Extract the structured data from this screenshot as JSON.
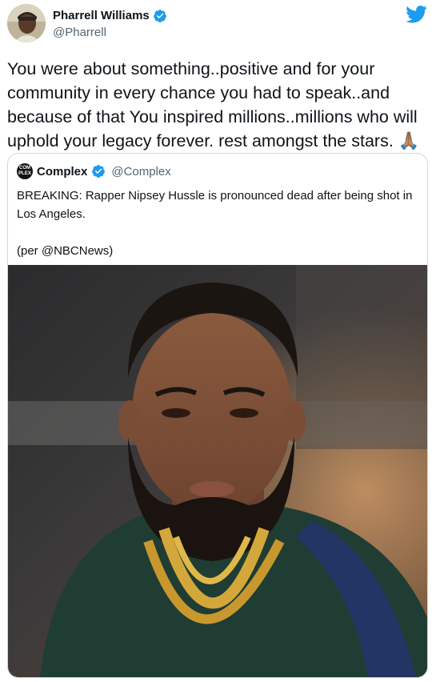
{
  "author": {
    "name": "Pharrell Williams",
    "handle": "@Pharrell",
    "verified": true,
    "avatar_icon": "profile-photo"
  },
  "brand_icon": "twitter-bird-icon",
  "tweet": {
    "text": "You were about something..positive and for your community in every chance you had to speak..and because of that You inspired millions..millions who will uphold your legacy forever. rest amongst the stars. 🙏🏽"
  },
  "quoted_tweet": {
    "author": {
      "name": "Complex",
      "handle": "@Complex",
      "verified": true,
      "avatar_text_line1": "COM",
      "avatar_text_line2": "PLEX"
    },
    "text_line1": "BREAKING: Rapper Nipsey Hussle is pronounced dead after being shot in Los Angeles.",
    "text_line2": "(per @NBCNews)",
    "image_icon": "portrait-photo"
  },
  "colors": {
    "verified": "#1d9bf0",
    "twitter_blue": "#1d9bf0",
    "handle_gray": "#536471",
    "border": "#cfd9de"
  }
}
